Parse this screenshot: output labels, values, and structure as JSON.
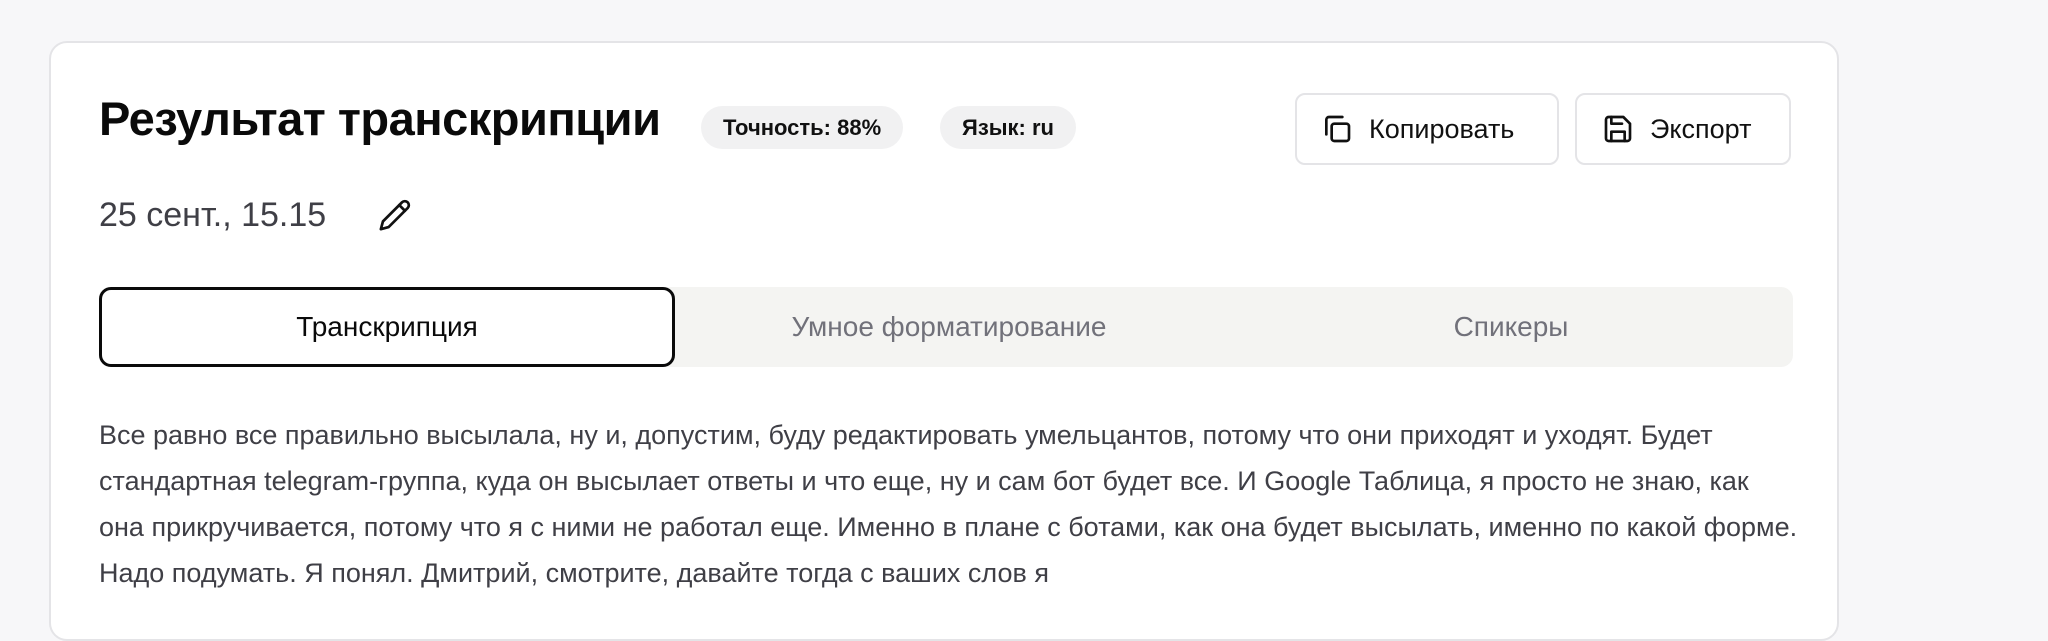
{
  "header": {
    "title": "Результат транскрипции",
    "accuracy_badge": "Точность: 88%",
    "language_badge": "Язык: ru",
    "copy_label": "Копировать",
    "export_label": "Экспорт"
  },
  "meta": {
    "date": "25 сент., 15.15"
  },
  "tabs": [
    {
      "label": "Транскрипция",
      "active": true
    },
    {
      "label": "Умное форматирование",
      "active": false
    },
    {
      "label": "Спикеры",
      "active": false
    }
  ],
  "transcript": {
    "text": "Все равно все правильно высылала, ну и, допустим, буду редактировать умельцантов, потому что они приходят и уходят. Будет стандартная telegram-группа, куда он высылает ответы и что еще, ну и сам бот будет все. И Google Таблица, я просто не знаю, как она прикручивается, потому что я с ними не работал еще. Именно в плане с ботами, как она будет высылать, именно по какой форме. Надо подумать. Я понял. Дмитрий, смотрите, давайте тогда с ваших слов я"
  },
  "icons": {
    "copy": "copy-icon",
    "export": "save-icon",
    "edit": "pencil-icon"
  }
}
